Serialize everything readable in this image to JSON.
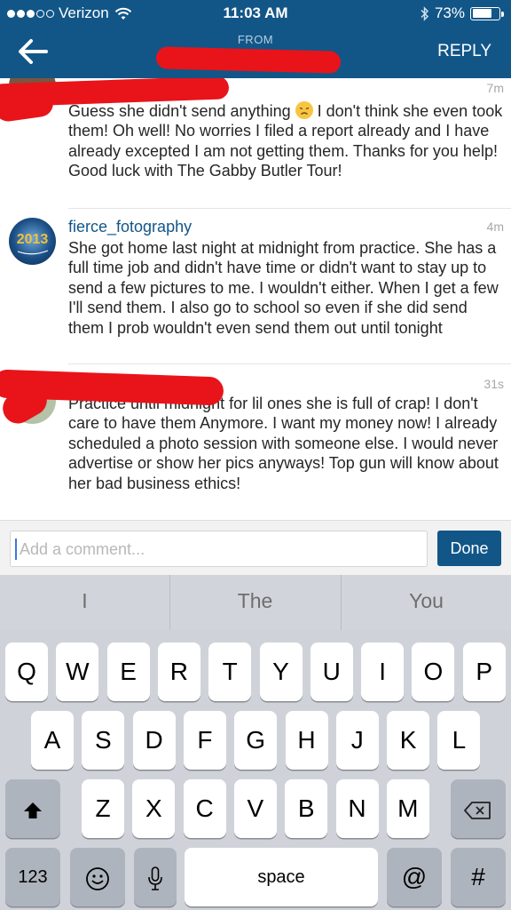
{
  "status_bar": {
    "carrier": "Verizon",
    "time": "11:03 AM",
    "battery": "73%",
    "battery_level": 0.73
  },
  "nav": {
    "from_label": "FROM",
    "reply_label": "REPLY"
  },
  "comments": [
    {
      "username": "",
      "time": "7m",
      "text_before_emoji": "Guess she didn't send anything",
      "text_after_emoji": "I don't think she even took them! Oh well! No worries I filed a report already and I have already excepted I am not getting them. Thanks for you help! Good luck with The Gabby Butler Tour!"
    },
    {
      "username": "fierce_fotography",
      "time": "4m",
      "text": "She got home last night at midnight from practice. She has a full time job and didn't have time or didn't want to stay up to send a few pictures to me. I wouldn't either. When I get a few I'll send them. I also go to school so even if she did send them I prob wouldn't even send them out until tonight",
      "avatar_text": "2013"
    },
    {
      "username": "",
      "time": "31s",
      "text": "Practice until midnight for lil ones she is full of crap! I don't care to have them Anymore. I want my money now! I already scheduled a photo session with someone else. I would never advertise or show her pics anyways! Top gun will know about her bad business ethics!"
    }
  ],
  "comment_input": {
    "placeholder": "Add a comment...",
    "done_label": "Done"
  },
  "keyboard": {
    "suggestions": [
      "I",
      "The",
      "You"
    ],
    "row1": [
      "Q",
      "W",
      "E",
      "R",
      "T",
      "Y",
      "U",
      "I",
      "O",
      "P"
    ],
    "row2": [
      "A",
      "S",
      "D",
      "F",
      "G",
      "H",
      "J",
      "K",
      "L"
    ],
    "row3": [
      "Z",
      "X",
      "C",
      "V",
      "B",
      "N",
      "M"
    ],
    "numbers_label": "123",
    "space_label": "space",
    "at_label": "@",
    "hash_label": "#"
  },
  "colors": {
    "header": "#125688",
    "username": "#125688",
    "redaction": "#e8141a"
  },
  "icons": [
    "back-arrow-icon",
    "wifi-icon",
    "bluetooth-icon",
    "battery-icon",
    "shift-icon",
    "delete-icon",
    "emoji-icon",
    "microphone-icon",
    "disappointed-face-emoji"
  ]
}
